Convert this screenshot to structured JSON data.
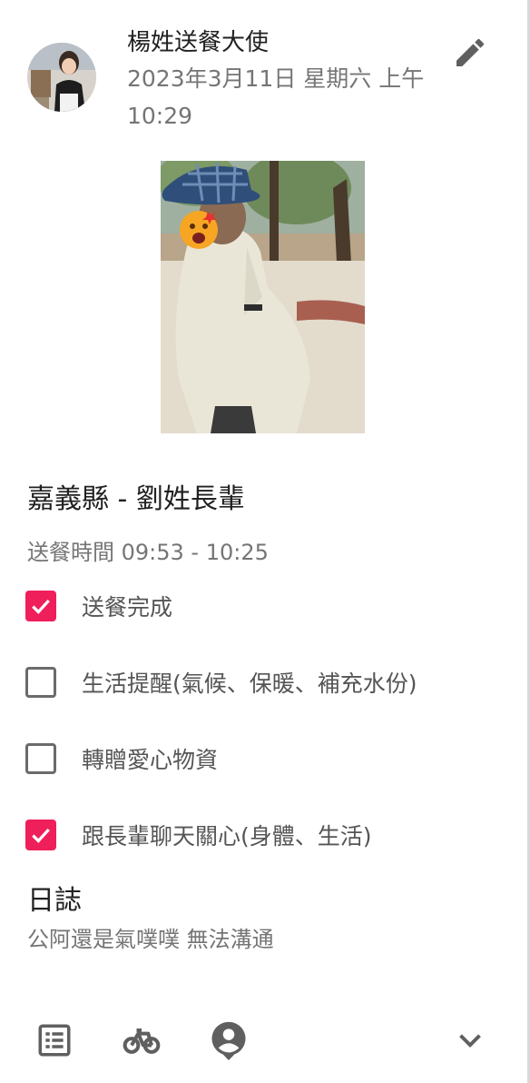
{
  "post": {
    "author_name": "楊姓送餐大使",
    "timestamp": "2023年3月11日 星期六 上午10:29"
  },
  "toolbar": {
    "edit_icon": "pencil-icon"
  },
  "delivery": {
    "recipient": "嘉義縣 - 劉姓長輩",
    "time": "送餐時間 09:53 - 10:25",
    "checklist": [
      {
        "label": "送餐完成",
        "checked": true
      },
      {
        "label": "生活提醒(氣候、保暖、補充水份)",
        "checked": false
      },
      {
        "label": "轉贈愛心物資",
        "checked": false
      },
      {
        "label": "跟長輩聊天關心(身體、生活)",
        "checked": true
      }
    ]
  },
  "log": {
    "heading": "日誌",
    "text": "公阿還是氣噗噗 無法溝通"
  },
  "bottom_bar": {
    "icons": [
      "list-icon",
      "bicycle-icon",
      "person-pin-icon",
      "chevron-down-icon"
    ]
  },
  "colors": {
    "accent": "#ef1f5c",
    "secondary_text": "#757575",
    "icon": "#5f5f5f"
  }
}
